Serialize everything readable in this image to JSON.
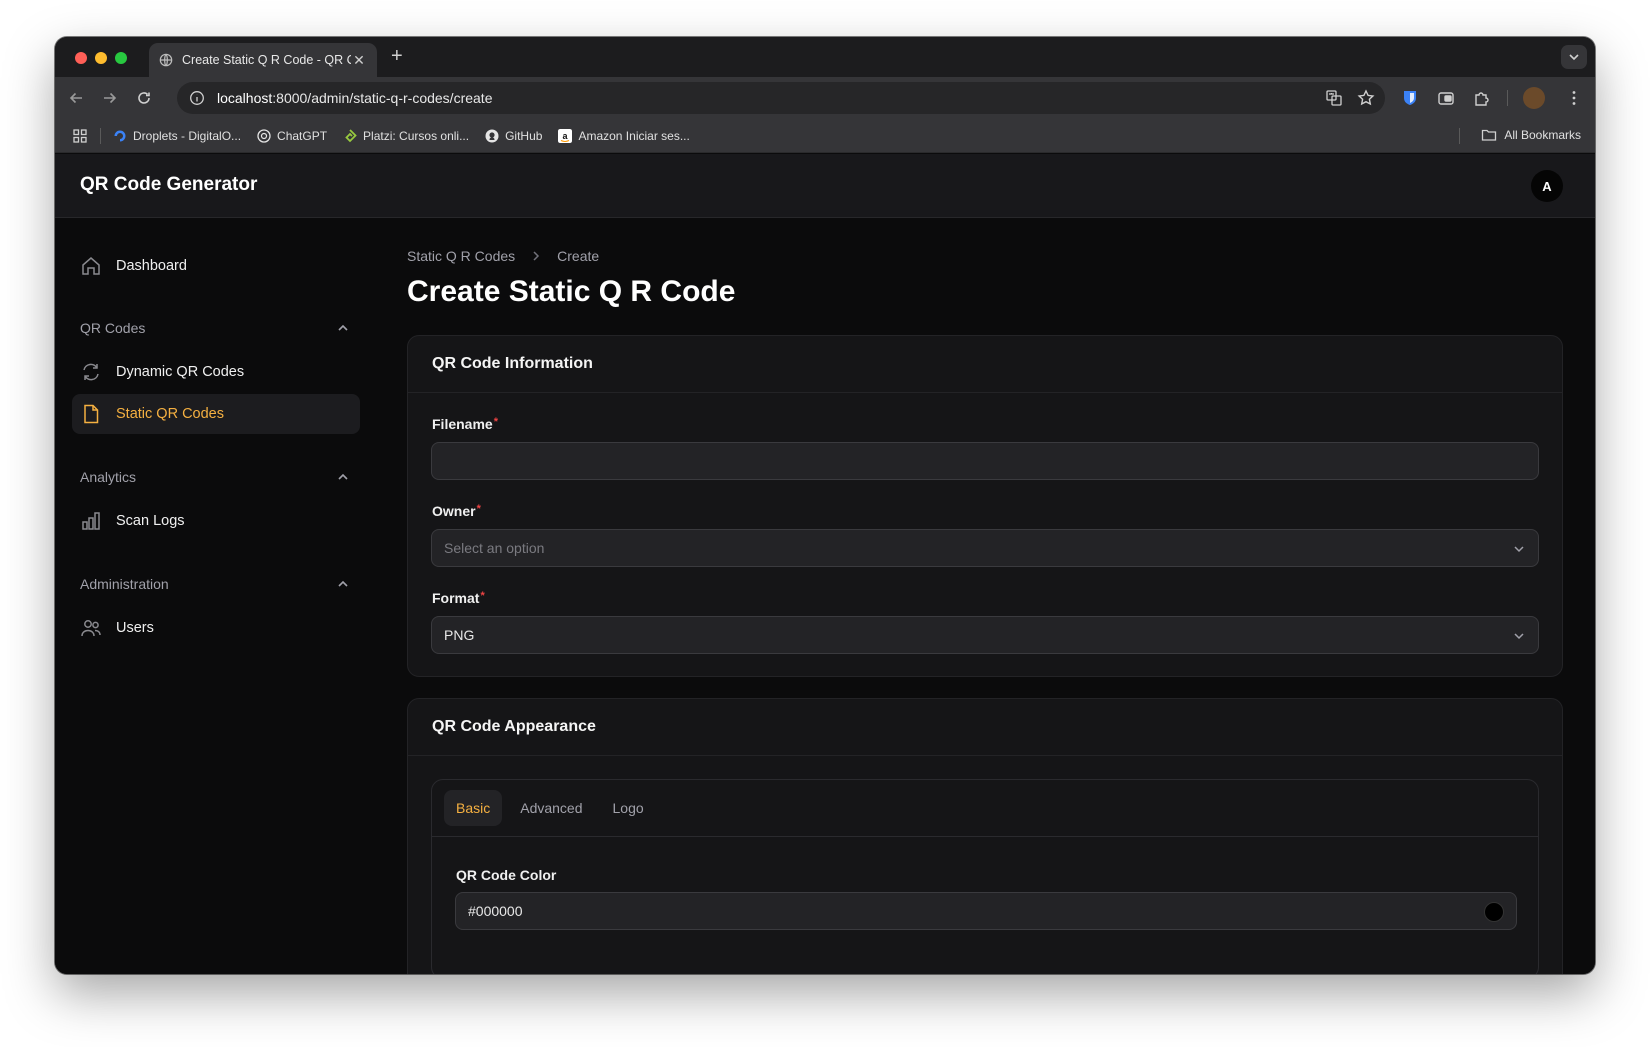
{
  "browser": {
    "tab_title": "Create Static Q R Code - QR Code Generator",
    "url_host": "localhost",
    "url_rest": ":8000/admin/static-q-r-codes/create",
    "bookmarks": [
      {
        "label": "Droplets - DigitalO...",
        "icon": "digitalocean-icon",
        "color": "#3b82f6"
      },
      {
        "label": "ChatGPT",
        "icon": "chatgpt-icon",
        "color": "#e5e5e5"
      },
      {
        "label": "Platzi: Cursos onli...",
        "icon": "platzi-icon",
        "color": "#98ca3f"
      },
      {
        "label": "GitHub",
        "icon": "github-icon",
        "color": "#e5e5e5"
      },
      {
        "label": "Amazon Iniciar ses...",
        "icon": "amazon-icon",
        "color": "#ffffff"
      }
    ],
    "all_bookmarks": "All Bookmarks"
  },
  "app": {
    "brand": "QR Code Generator",
    "avatar_initial": "A"
  },
  "sidebar": {
    "dashboard": "Dashboard",
    "groups": [
      {
        "label": "QR Codes",
        "items": [
          "Dynamic QR Codes",
          "Static QR Codes"
        ]
      },
      {
        "label": "Analytics",
        "items": [
          "Scan Logs"
        ]
      },
      {
        "label": "Administration",
        "items": [
          "Users"
        ]
      }
    ],
    "active_item": "Static QR Codes"
  },
  "main": {
    "breadcrumb": [
      "Static Q R Codes",
      "Create"
    ],
    "title": "Create Static Q R Code",
    "info_card": {
      "title": "QR Code Information",
      "filename_label": "Filename",
      "filename_value": "",
      "owner_label": "Owner",
      "owner_placeholder": "Select an option",
      "format_label": "Format",
      "format_value": "PNG",
      "required_mark": "*"
    },
    "appearance_card": {
      "title": "QR Code Appearance",
      "tabs": [
        "Basic",
        "Advanced",
        "Logo"
      ],
      "active_tab": "Basic",
      "color_label": "QR Code Color",
      "color_value": "#000000"
    }
  },
  "colors": {
    "accent": "#f5b041",
    "required": "#ef4444"
  }
}
